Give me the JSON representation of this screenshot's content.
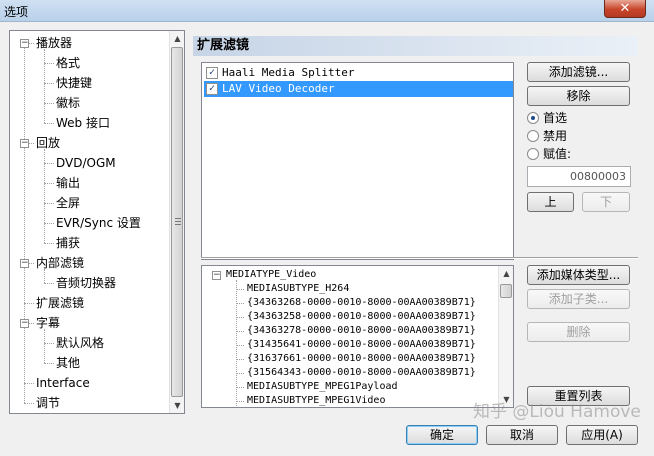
{
  "window": {
    "title": "选项",
    "close_glyph": "✕"
  },
  "tree": {
    "items": [
      {
        "label": "播放器",
        "level": 0,
        "expander": "−"
      },
      {
        "label": "格式",
        "level": 1
      },
      {
        "label": "快捷键",
        "level": 1
      },
      {
        "label": "徽标",
        "level": 1
      },
      {
        "label": "Web 接口",
        "level": 1
      },
      {
        "label": "回放",
        "level": 0,
        "expander": "−"
      },
      {
        "label": "DVD/OGM",
        "level": 1
      },
      {
        "label": "输出",
        "level": 1
      },
      {
        "label": "全屏",
        "level": 1
      },
      {
        "label": "EVR/Sync 设置",
        "level": 1
      },
      {
        "label": "捕获",
        "level": 1
      },
      {
        "label": "内部滤镜",
        "level": 0,
        "expander": "−"
      },
      {
        "label": "音频切换器",
        "level": 1
      },
      {
        "label": "扩展滤镜",
        "level": 0,
        "selected": true
      },
      {
        "label": "字幕",
        "level": 0,
        "expander": "−"
      },
      {
        "label": "默认风格",
        "level": 1
      },
      {
        "label": "其他",
        "level": 1
      },
      {
        "label": "Interface",
        "level": 0
      },
      {
        "label": "调节",
        "level": 0
      }
    ]
  },
  "panel": {
    "title": "扩展滤镜",
    "filters": [
      {
        "name": "Haali Media Splitter",
        "checked": true,
        "selected": false
      },
      {
        "name": "LAV Video Decoder",
        "checked": true,
        "selected": true
      }
    ],
    "buttons": {
      "add_filter": "添加滤镜...",
      "remove": "移除",
      "up": "上",
      "down": "下",
      "add_media_type": "添加媒体类型...",
      "add_subtype": "添加子类...",
      "delete": "删除",
      "reset_list": "重置列表"
    },
    "merit": {
      "options": [
        {
          "label": "首选",
          "checked": true
        },
        {
          "label": "禁用",
          "checked": false
        },
        {
          "label": "赋值:",
          "checked": false
        }
      ],
      "value": "00800003"
    },
    "media_types": {
      "root": "MEDIATYPE_Video",
      "children": [
        "MEDIASUBTYPE_H264",
        "{34363268-0000-0010-8000-00AA00389B71}",
        "{34363258-0000-0010-8000-00AA00389B71}",
        "{34363278-0000-0010-8000-00AA00389B71}",
        "{31435641-0000-0010-8000-00AA00389B71}",
        "{31637661-0000-0010-8000-00AA00389B71}",
        "{31564343-0000-0010-8000-00AA00389B71}",
        "MEDIASUBTYPE_MPEG1Payload",
        "MEDIASUBTYPE_MPEG1Video"
      ]
    }
  },
  "footer": {
    "ok": "确定",
    "cancel": "取消",
    "apply": "应用(A)"
  },
  "watermark": "知乎 @Liou Hamove"
}
